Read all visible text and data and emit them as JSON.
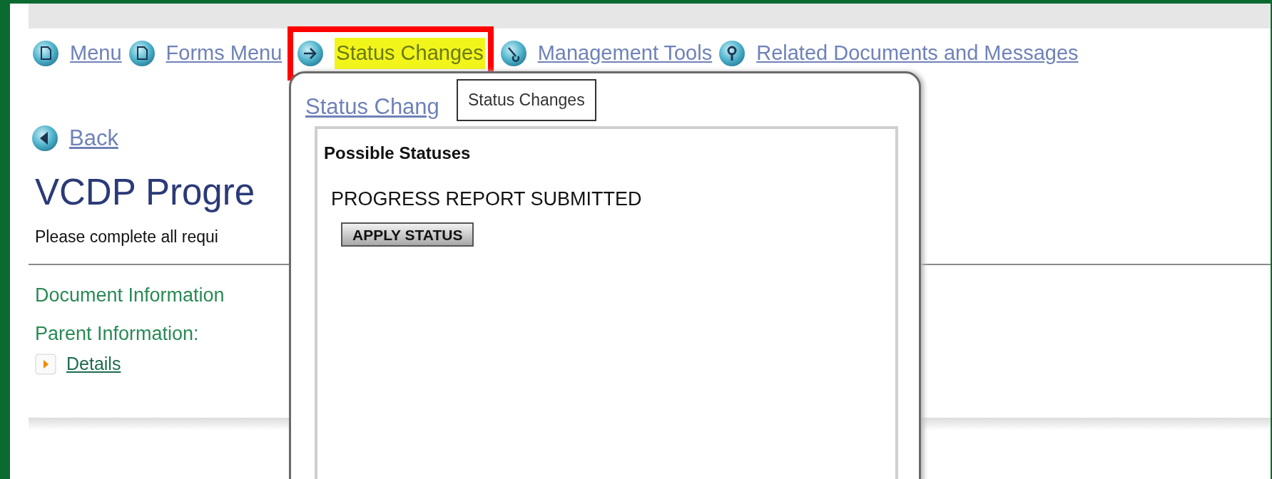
{
  "nav": [
    {
      "label": "Menu",
      "highlighted": false
    },
    {
      "label": "Forms Menu",
      "highlighted": false
    },
    {
      "label": "Status Changes",
      "highlighted": true
    },
    {
      "label": "Management Tools",
      "highlighted": false
    },
    {
      "label": "Related Documents and Messages",
      "highlighted": false
    }
  ],
  "back": "Back",
  "title": "VCDP Progre",
  "instructions": "Please complete all requi",
  "sections": [
    "Document Information",
    "Parent Information:"
  ],
  "details": "Details",
  "popup": {
    "link": "Status Chang",
    "tooltip": "Status Changes",
    "heading": "Possible Statuses",
    "statuses": [
      {
        "name": "PROGRESS REPORT SUBMITTED",
        "button": "APPLY STATUS"
      }
    ]
  }
}
